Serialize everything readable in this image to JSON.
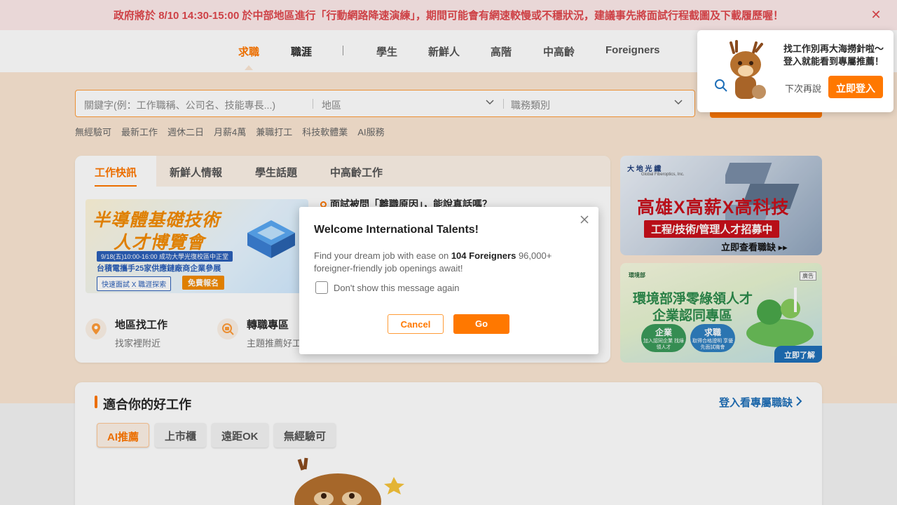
{
  "announcement": {
    "text": "政府將於 8/10 14:30-15:00 於中部地區進行「行動網路降速演練」，期間可能會有網速較慢或不穩狀況，建議事先將面試行程截圖及下載履歷喔！",
    "close_icon": "close-icon"
  },
  "nav": {
    "items": [
      {
        "label": "求職",
        "active": true
      },
      {
        "label": "職涯",
        "active": false
      },
      {
        "label": "學生",
        "active": false
      },
      {
        "label": "新鮮人",
        "active": false
      },
      {
        "label": "高階",
        "active": false
      },
      {
        "label": "中高齡",
        "active": false
      },
      {
        "label": "Foreigners",
        "active": false
      }
    ]
  },
  "search": {
    "keyword_placeholder": "關鍵字(例：工作職稱、公司名、技能專長...)",
    "area_label": "地區",
    "category_label": "職務類別"
  },
  "hot_tags": [
    "無經驗可",
    "最新工作",
    "週休二日",
    "月薪4萬",
    "兼職打工",
    "科技軟體業",
    "AI服務"
  ],
  "news": {
    "tabs": [
      "工作快訊",
      "新鮮人情報",
      "學生話題",
      "中高齡工作"
    ],
    "active_tab": "工作快訊",
    "banner": {
      "title_line1": "半導體基礎技術",
      "title_line2": "人才博覽會",
      "date": "9/18(五)10:00-16:00  成功大學光復校區中正堂",
      "line": "台積電攜手25家供應鏈廠商企業參展",
      "btn1": "快速面試 X 職涯探索",
      "btn2": "免費報名"
    },
    "headline": "面試被問「離職原因」，能說真話嗎？",
    "quick_links": [
      {
        "title": "地區找工作",
        "sub": "找家裡附近",
        "icon": "location-pin-icon"
      },
      {
        "title": "轉職專區",
        "sub": "主題推薦好工",
        "icon": "search-briefcase-icon"
      }
    ]
  },
  "banner_right_1": {
    "logo": "大 地 光 纖",
    "logo_sub": "Global Fiberoptics, Inc.",
    "title": "高雄X高薪X高科技",
    "subtitle": "工程/技術/管理人才招募中",
    "cta": "立即查看職缺 ▸▸"
  },
  "banner_right_2": {
    "logo": "環境部",
    "ad": "廣告",
    "title_line1": "環境部淨零綠領人才",
    "title_line2": "企業認同專區",
    "pill1_title": "企業",
    "pill1_sub": "加入認同企業 找綠領人才",
    "pill2_title": "求職",
    "pill2_sub": "取得合格證明 享優先面試機會",
    "cta": "立即了解"
  },
  "jobs": {
    "title": "適合你的好工作",
    "login_link": "登入看專屬職缺",
    "chips": [
      "AI推薦",
      "上市櫃",
      "遠距OK",
      "無經驗可"
    ],
    "active_chip": "AI推薦"
  },
  "login_popup": {
    "line1": "找工作別再大海撈針啦～",
    "line2": "登入就能看到專屬推薦！",
    "later": "下次再說",
    "login": "立即登入"
  },
  "modal": {
    "title": "Welcome International Talents!",
    "body_prefix": "Find your dream job with ease on ",
    "body_brand": "104 Foreigners",
    "body_suffix": " 96,000+ foreigner-friendly job openings await!",
    "checkbox_label": "Don't show this message again",
    "cancel": "Cancel",
    "go": "Go"
  },
  "colors": {
    "brand": "#ff7800",
    "announce_bg": "#fdeaea",
    "announce_text": "#e0474c",
    "hero_bg": "#fbe7d3",
    "link_blue": "#1f6fb8"
  }
}
